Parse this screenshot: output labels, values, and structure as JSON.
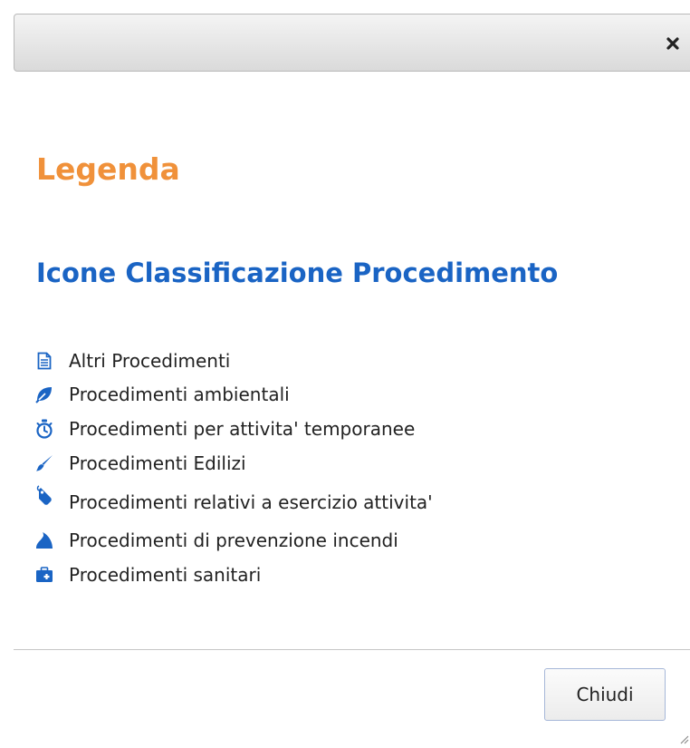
{
  "dialog": {
    "close_icon": "close-icon",
    "heading": "Legenda",
    "section_heading": "Icone Classificazione Procedimento",
    "items": [
      {
        "icon": "document-icon",
        "label": "Altri Procedimenti"
      },
      {
        "icon": "leaf-icon",
        "label": "Procedimenti ambientali"
      },
      {
        "icon": "stopwatch-icon",
        "label": "Procedimenti per attivita' temporanee"
      },
      {
        "icon": "brush-icon",
        "label": "Procedimenti Edilizi"
      },
      {
        "icon": "tag-icon",
        "label": "Procedimenti relativi a esercizio attivita'"
      },
      {
        "icon": "fire-icon",
        "label": "Procedimenti di prevenzione incendi"
      },
      {
        "icon": "medkit-icon",
        "label": "Procedimenti sanitari"
      }
    ],
    "close_button_label": "Chiudi"
  },
  "colors": {
    "heading": "#f0913a",
    "section_heading": "#1a64c4",
    "icons": "#1a64c4"
  }
}
